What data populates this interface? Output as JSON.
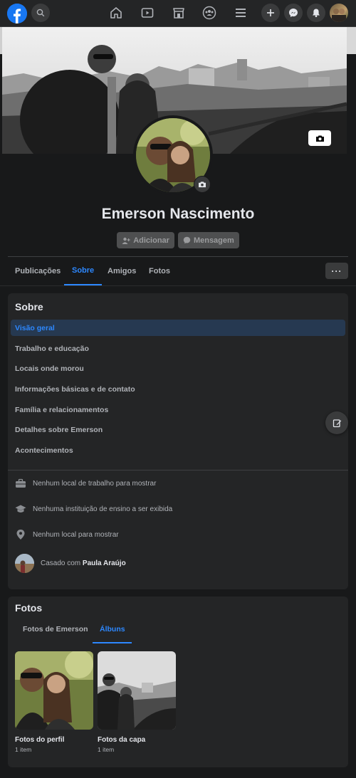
{
  "topbar": {
    "logo_icon": "facebook-logo-icon",
    "nav_icons": [
      "home-icon",
      "watch-icon",
      "marketplace-icon",
      "groups-icon",
      "menu-icon"
    ],
    "action_icons": [
      "plus-icon",
      "messenger-icon",
      "notifications-icon"
    ]
  },
  "profile": {
    "name": "Emerson Nascimento",
    "add_label": "Adicionar",
    "message_label": "Mensagem"
  },
  "tabs": [
    {
      "label": "Publicações"
    },
    {
      "label": "Sobre"
    },
    {
      "label": "Amigos"
    },
    {
      "label": "Fotos"
    }
  ],
  "tabs_active": "Sobre",
  "more_label": "···",
  "about": {
    "title": "Sobre",
    "items": [
      {
        "label": "Visão geral"
      },
      {
        "label": "Trabalho e educação"
      },
      {
        "label": "Locais onde morou"
      },
      {
        "label": "Informações básicas e de contato"
      },
      {
        "label": "Família e relacionamentos"
      },
      {
        "label": "Detalhes sobre Emerson"
      },
      {
        "label": "Acontecimentos"
      }
    ],
    "work": "Nenhum local de trabalho para mostrar",
    "education": "Nenhuma instituição de ensino a ser exibida",
    "places": "Nenhum local para mostrar",
    "relationship_prefix": "Casado com",
    "spouse_name": "Paula Araújo"
  },
  "photos": {
    "title": "Fotos",
    "tabs": [
      {
        "label": "Fotos de Emerson"
      },
      {
        "label": "Álbuns"
      }
    ],
    "albums": [
      {
        "title": "Fotos do perfil",
        "count": "1 item"
      },
      {
        "title": "Fotos da capa",
        "count": "1 item"
      }
    ]
  },
  "colors": {
    "accent": "#2d88ff",
    "background": "#18191a",
    "card": "#242526"
  }
}
